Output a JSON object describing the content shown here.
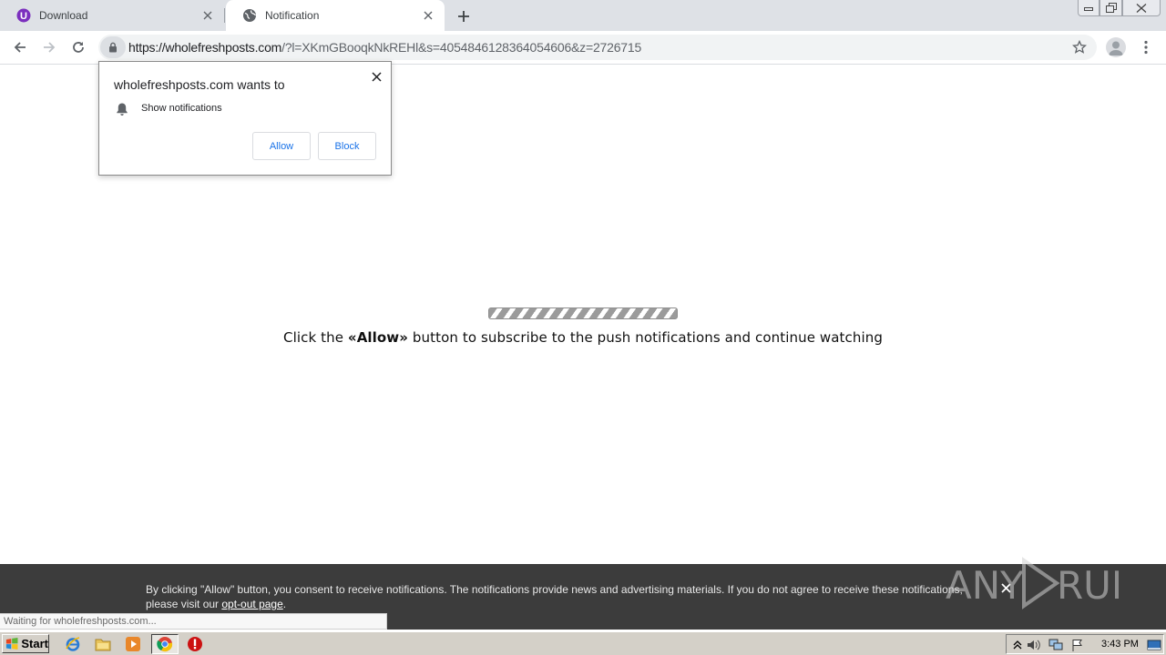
{
  "browser": {
    "tabs": [
      {
        "label": "Download",
        "active": false,
        "favicon": "u-logo-icon"
      },
      {
        "label": "Notification",
        "active": true,
        "favicon": "globe-icon"
      }
    ],
    "url_host": "https://wholefreshposts.com",
    "url_path": "/?l=XKmGBooqkNkREHl&s=4054846128364054606&z=2726715"
  },
  "permission_prompt": {
    "title": "wholefreshposts.com wants to",
    "description": "Show notifications",
    "allow_label": "Allow",
    "block_label": "Block"
  },
  "page": {
    "message_before": "Click the ",
    "message_bold": "«Allow»",
    "message_after": " button to subscribe to the push notifications and continue watching"
  },
  "consent_bar": {
    "text": "By clicking \"Allow\" button, you consent to receive notifications. The notifications provide news and advertising materials. If you do not agree to receive these notifications, please visit our ",
    "link_text": "opt-out page",
    "text_end": "."
  },
  "watermark": "ANY RUN",
  "status_bubble": "Waiting for wholefreshposts.com...",
  "taskbar": {
    "start_label": "Start",
    "clock": "3:43 PM"
  },
  "colors": {
    "tab_strip": "#dee1e6",
    "link_blue": "#1a73e8",
    "consent_bg": "#3c3c3c",
    "taskbar": "#d4d0c8"
  }
}
